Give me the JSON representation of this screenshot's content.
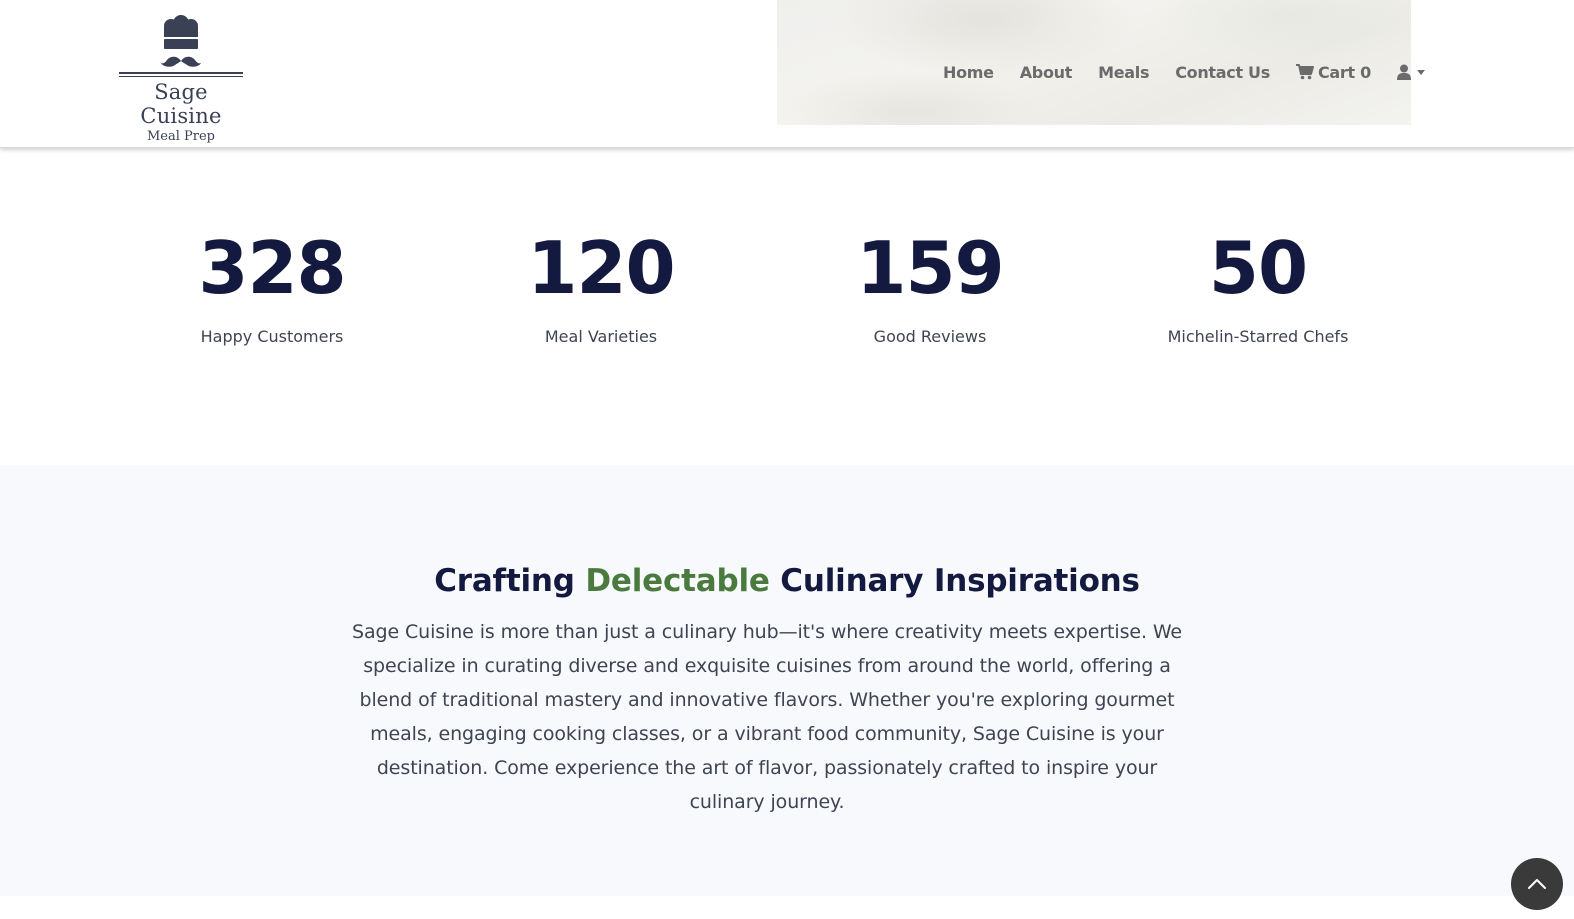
{
  "brand": {
    "name": "Sage Cuisine",
    "tagline": "Meal Prep"
  },
  "nav": {
    "home": "Home",
    "about": "About",
    "meals": "Meals",
    "contact": "Contact Us",
    "cart": "Cart 0"
  },
  "stats": [
    {
      "value": "328",
      "label": "Happy Customers"
    },
    {
      "value": "120",
      "label": "Meal Varieties"
    },
    {
      "value": "159",
      "label": "Good Reviews"
    },
    {
      "value": "50",
      "label": "Michelin-Starred Chefs"
    }
  ],
  "about": {
    "title_part1": "Crafting ",
    "title_accent": "Delectable",
    "title_part2": " Culinary Inspirations",
    "text": "Sage Cuisine is more than just a culinary hub—it's where creativity meets expertise. We specialize in curating diverse and exquisite cuisines from around the world, offering a blend of traditional mastery and innovative flavors. Whether you're exploring gourmet meals, engaging cooking classes, or a vibrant food community, Sage Cuisine is your destination. Come experience the art of flavor, passionately crafted to inspire your culinary journey."
  },
  "colors": {
    "navy": "#141a3f",
    "accent_green": "#4a7a3d",
    "nav_gray": "#6b6b6b",
    "section_bg": "#f8f9fc"
  },
  "icons": {
    "logo": "chef-hat-mustache-icon",
    "cart": "cart-icon",
    "user": "user-icon",
    "caret": "caret-down-icon",
    "scroll_top": "chevron-up-icon"
  }
}
